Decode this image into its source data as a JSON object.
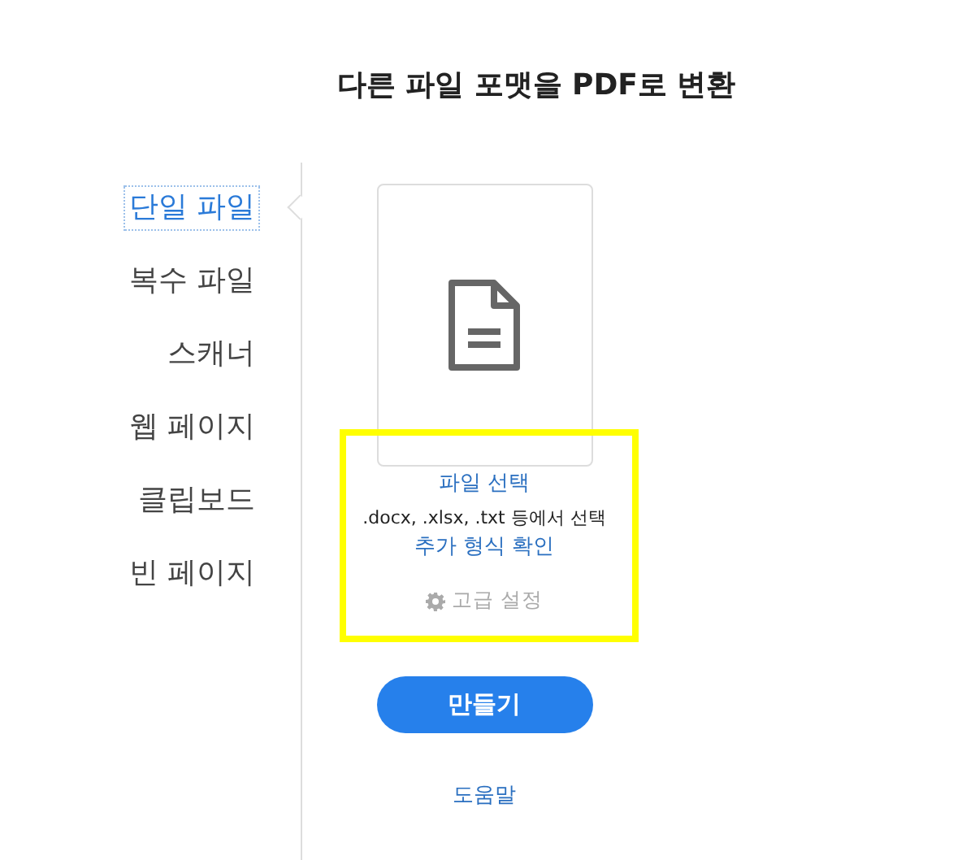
{
  "title": "다른 파일 포맷을 PDF로 변환",
  "sidebar": {
    "items": [
      {
        "label": "단일 파일",
        "selected": true
      },
      {
        "label": "복수 파일",
        "selected": false
      },
      {
        "label": "스캐너",
        "selected": false
      },
      {
        "label": "웹 페이지",
        "selected": false
      },
      {
        "label": "클립보드",
        "selected": false
      },
      {
        "label": "빈 페이지",
        "selected": false
      }
    ]
  },
  "panel": {
    "select_link": "파일 선택",
    "hint": ".docx, .xlsx, .txt 등에서 선택",
    "formats_link": "추가 형식 확인",
    "advanced": {
      "label": "고급 설정",
      "disabled": true
    }
  },
  "create_button": "만들기",
  "help_link": "도움말"
}
